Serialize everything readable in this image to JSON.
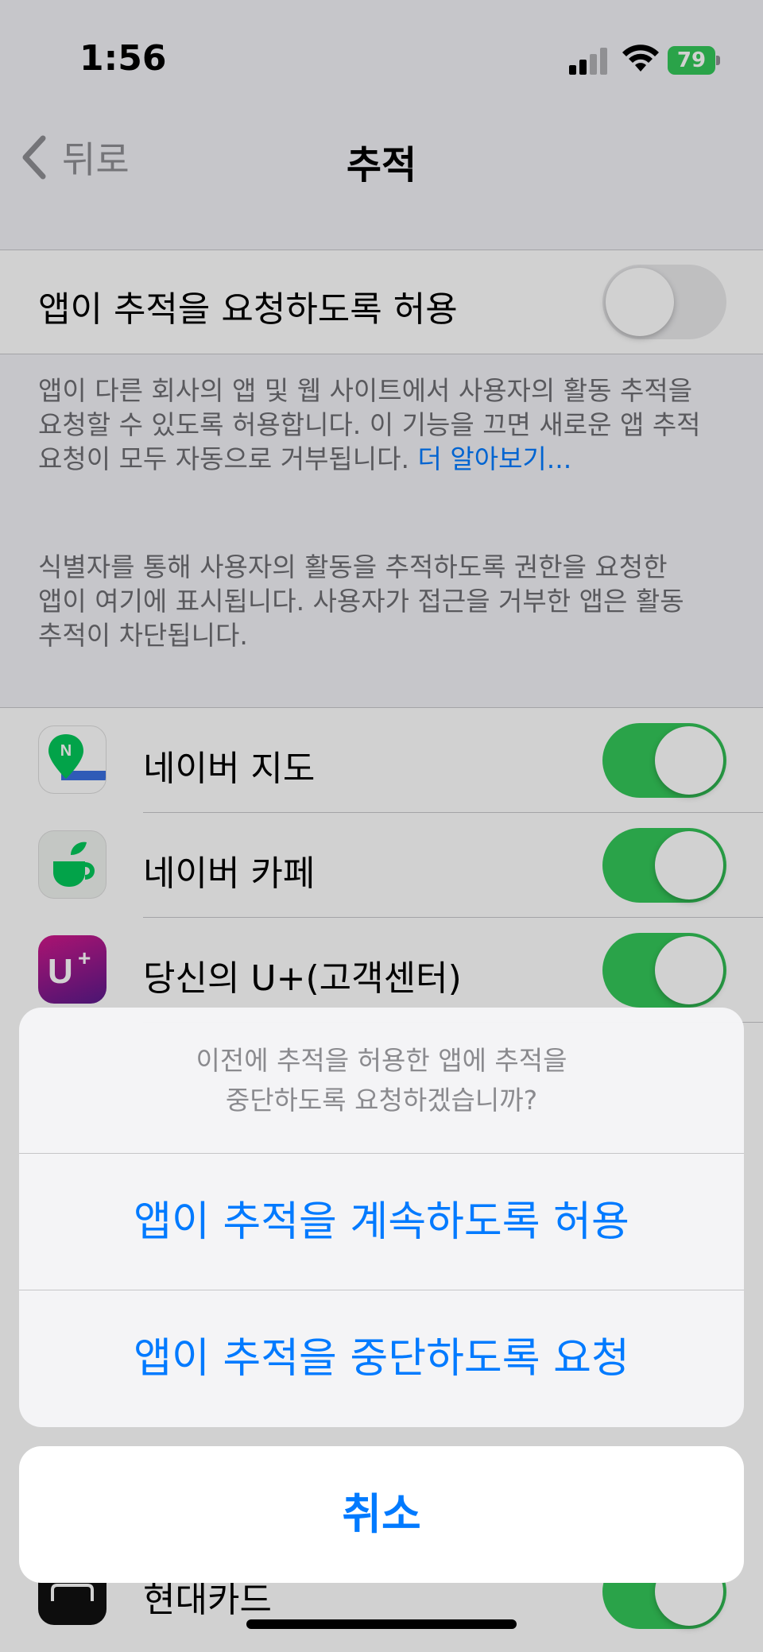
{
  "status_bar": {
    "time": "1:56",
    "battery": "79"
  },
  "nav": {
    "back_label": "뒤로",
    "title": "추적"
  },
  "main_toggle": {
    "label": "앱이 추적을 요청하도록 허용",
    "state": "off"
  },
  "footnote_1": {
    "line1": "앱이 다른 회사의 앱 및 웹 사이트에서 사용자의 활동 추적을",
    "line2": "요청할 수 있도록 허용합니다. 이 기능을 끄면 새로운 앱 추적",
    "line3": "요청이 모두 자동으로 거부됩니다.",
    "link": "더 알아보기..."
  },
  "footnote_2": {
    "line1": "식별자를 통해 사용자의 활동을 추적하도록 권한을 요청한",
    "line2": "앱이 여기에 표시됩니다. 사용자가 접근을 거부한 앱은 활동",
    "line3": "추적이 차단됩니다."
  },
  "apps": [
    {
      "name": "네이버 지도",
      "icon": "naver-map-icon",
      "state": "on"
    },
    {
      "name": "네이버 카페",
      "icon": "naver-cafe-icon",
      "state": "on"
    },
    {
      "name": "당신의 U+(고객센터)",
      "icon": "uplus-icon",
      "state": "on"
    },
    {
      "name": "현대카드",
      "icon": "hyundai-card-icon",
      "state": "on"
    }
  ],
  "action_sheet": {
    "message_line1": "이전에 추적을 허용한 앱에 추적을",
    "message_line2": "중단하도록 요청하겠습니까?",
    "allow_label": "앱이 추적을 계속하도록 허용",
    "stop_label": "앱이 추적을 중단하도록 요청",
    "cancel_label": "취소"
  },
  "colors": {
    "accent": "#007aff",
    "toggle_on": "#34c759",
    "toggle_off": "#e9e9eb"
  }
}
